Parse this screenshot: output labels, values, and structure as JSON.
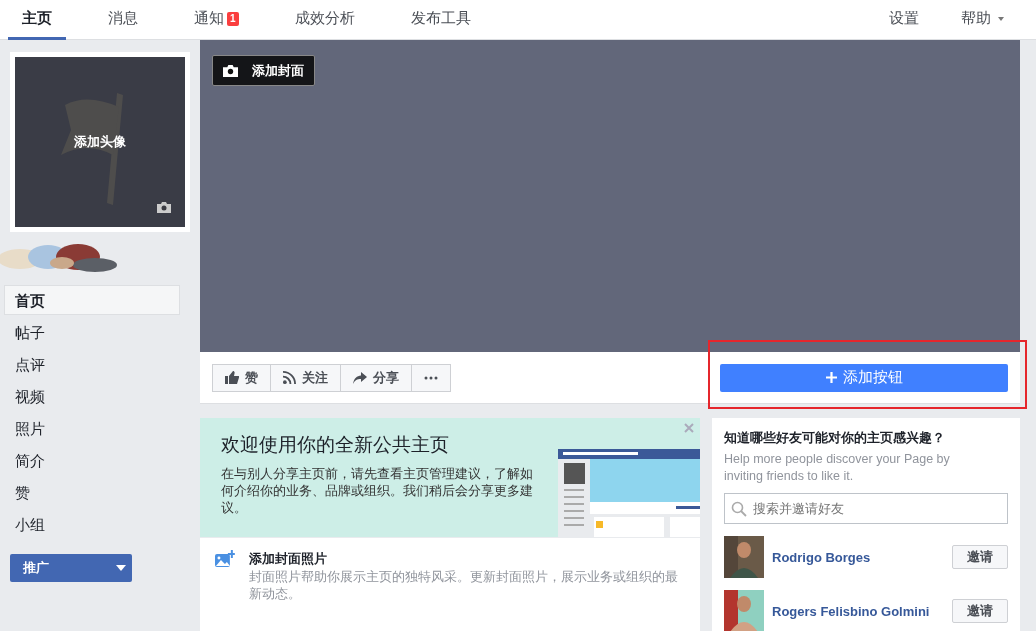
{
  "top_nav": {
    "tabs": [
      {
        "label": "主页",
        "selected": true
      },
      {
        "label": "消息",
        "selected": false
      },
      {
        "label": "通知",
        "selected": false,
        "badge": "1"
      },
      {
        "label": "成效分析",
        "selected": false
      },
      {
        "label": "发布工具",
        "selected": false
      }
    ],
    "right": [
      {
        "label": "设置",
        "dropdown": false
      },
      {
        "label": "帮助",
        "dropdown": true
      }
    ]
  },
  "sidebar": {
    "profile_photo": {
      "label": "添加头像"
    },
    "items": [
      {
        "label": "首页",
        "selected": true
      },
      {
        "label": "帖子",
        "selected": false
      },
      {
        "label": "点评",
        "selected": false
      },
      {
        "label": "视频",
        "selected": false
      },
      {
        "label": "照片",
        "selected": false
      },
      {
        "label": "简介",
        "selected": false
      },
      {
        "label": "赞",
        "selected": false
      },
      {
        "label": "小组",
        "selected": false
      }
    ],
    "promote_button": "推广"
  },
  "cover": {
    "add_cover_button": "添加封面"
  },
  "actions": [
    {
      "kind": "like",
      "label": "赞"
    },
    {
      "kind": "follow",
      "label": "关注"
    },
    {
      "kind": "share",
      "label": "分享"
    },
    {
      "kind": "more"
    }
  ],
  "add_button": {
    "label": "添加按钮",
    "highlighted": true
  },
  "welcome": {
    "title": "欢迎使用你的全新公共主页",
    "body": "在与别人分享主页前，请先查看主页管理建议，了解如何介绍你的业务、品牌或组织。我们稍后会分享更多建议。"
  },
  "tasks": [
    {
      "kind": "cover",
      "title": "添加封面照片",
      "description": "封面照片帮助你展示主页的独特风采。更新封面照片，展示业务或组织的最新动态。"
    }
  ],
  "invite": {
    "title": "知道哪些好友可能对你的主页感兴趣？",
    "subtitle": "Help more people discover your Page by inviting friends to like it.",
    "search": {
      "placeholder": "搜索并邀请好友"
    },
    "friends": [
      {
        "name": "Rodrigo Borges",
        "button": "邀请"
      },
      {
        "name": "Rogers Felisbino Golmini",
        "button": "邀请"
      }
    ]
  }
}
